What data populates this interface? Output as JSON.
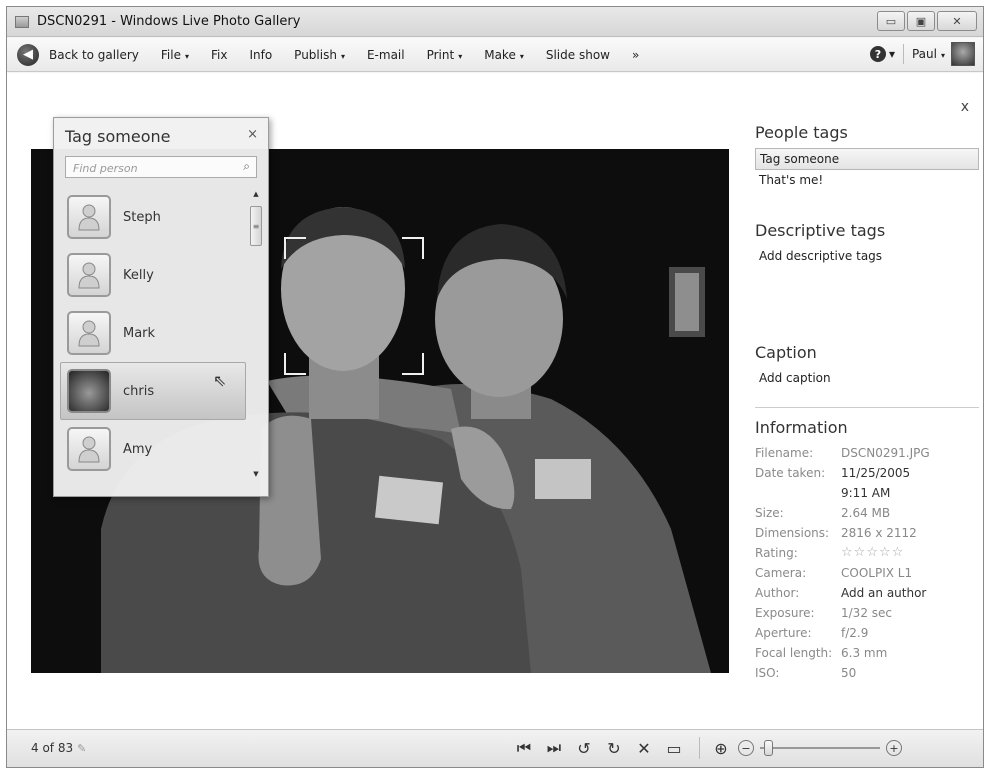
{
  "window": {
    "title": "DSCN0291 - Windows Live Photo Gallery",
    "min_glyph": "▭",
    "max_glyph": "▣",
    "close_glyph": "✕"
  },
  "toolbar": {
    "back_label": "Back to gallery",
    "items": [
      "File",
      "Fix",
      "Info",
      "Publish",
      "E-mail",
      "Print",
      "Make",
      "Slide show"
    ],
    "overflow": "»",
    "help_glyph": "?",
    "user": "Paul",
    "dropdown_arrow": "▾"
  },
  "tag_popup": {
    "title": "Tag someone",
    "close_glyph": "×",
    "search_placeholder": "Find person",
    "people": [
      "Steph",
      "Kelly",
      "Mark",
      "chris",
      "Amy"
    ],
    "selected": "chris"
  },
  "right_pane": {
    "close_glyph": "x",
    "people_tags_heading": "People tags",
    "tag_someone": "Tag someone",
    "thats_me": "That's me!",
    "descriptive_heading": "Descriptive tags",
    "add_descriptive": "Add descriptive tags",
    "caption_heading": "Caption",
    "add_caption": "Add caption",
    "info_heading": "Information",
    "info": {
      "filename_label": "Filename:",
      "filename": "DSCN0291.JPG",
      "date_label": "Date taken:",
      "date": "11/25/2005",
      "time": "9:11 AM",
      "size_label": "Size:",
      "size": "2.64 MB",
      "dimensions_label": "Dimensions:",
      "dimensions": "2816 x 2112",
      "rating_label": "Rating:",
      "rating": 0,
      "camera_label": "Camera:",
      "camera": "COOLPIX L1",
      "author_label": "Author:",
      "author": "Add an author",
      "exposure_label": "Exposure:",
      "exposure": "1/32 sec",
      "aperture_label": "Aperture:",
      "aperture": "f/2.9",
      "focal_label": "Focal length:",
      "focal": "6.3 mm",
      "iso_label": "ISO:",
      "iso": "50"
    }
  },
  "statusbar": {
    "count": "4 of 83"
  },
  "colors": {
    "photo_bg": "#0d0d0d",
    "accent_dark": "#333333"
  }
}
